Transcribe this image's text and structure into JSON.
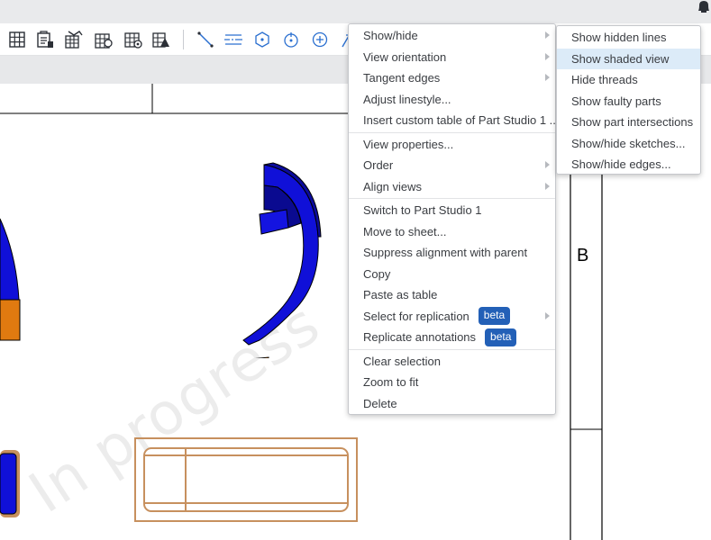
{
  "toolbar": {
    "icons": [
      "table-icon",
      "bom-icon",
      "hole-table-icon",
      "revision-table-icon",
      "weldment-table-icon",
      "inspection-table-icon",
      "line-icon",
      "centerline-icon",
      "centermark-icon",
      "point-icon",
      "add-circle-icon",
      "sketch-icon"
    ]
  },
  "colors": {
    "accent": "#2360b7",
    "highlight": "#dcebf8",
    "part_blue": "#1010d8",
    "part_orange": "#e07a10",
    "part_grey": "#8fa9bd",
    "outline_tan": "#c7905e"
  },
  "sheet": {
    "watermark": "In progress",
    "zone_label": "B"
  },
  "context_menu": {
    "groups": [
      [
        {
          "label": "Show/hide",
          "submenu": true
        },
        {
          "label": "View orientation",
          "submenu": true
        },
        {
          "label": "Tangent edges",
          "submenu": true
        },
        {
          "label": "Adjust linestyle...",
          "submenu": false
        },
        {
          "label": "Insert custom table of Part Studio 1 ...",
          "submenu": false
        }
      ],
      [
        {
          "label": "View properties...",
          "submenu": false
        },
        {
          "label": "Order",
          "submenu": true
        },
        {
          "label": "Align views",
          "submenu": true
        }
      ],
      [
        {
          "label": "Switch to Part Studio 1",
          "submenu": false
        },
        {
          "label": "Move to sheet...",
          "submenu": false
        },
        {
          "label": "Suppress alignment with parent",
          "submenu": false
        },
        {
          "label": "Copy",
          "submenu": false
        },
        {
          "label": "Paste as table",
          "submenu": false
        },
        {
          "label": "Select for replication",
          "submenu": true,
          "badge": "beta"
        },
        {
          "label": "Replicate annotations",
          "submenu": false,
          "badge": "beta"
        }
      ],
      [
        {
          "label": "Clear selection",
          "submenu": false
        },
        {
          "label": "Zoom to fit",
          "submenu": false
        },
        {
          "label": "Delete",
          "submenu": false
        }
      ]
    ]
  },
  "submenu": {
    "items": [
      {
        "label": "Show hidden lines",
        "highlighted": false
      },
      {
        "label": "Show shaded view",
        "highlighted": true
      },
      {
        "label": "Hide threads",
        "highlighted": false
      },
      {
        "label": "Show faulty parts",
        "highlighted": false
      },
      {
        "label": "Show part intersections",
        "highlighted": false
      },
      {
        "label": "Show/hide sketches...",
        "highlighted": false
      },
      {
        "label": "Show/hide edges...",
        "highlighted": false
      }
    ]
  }
}
